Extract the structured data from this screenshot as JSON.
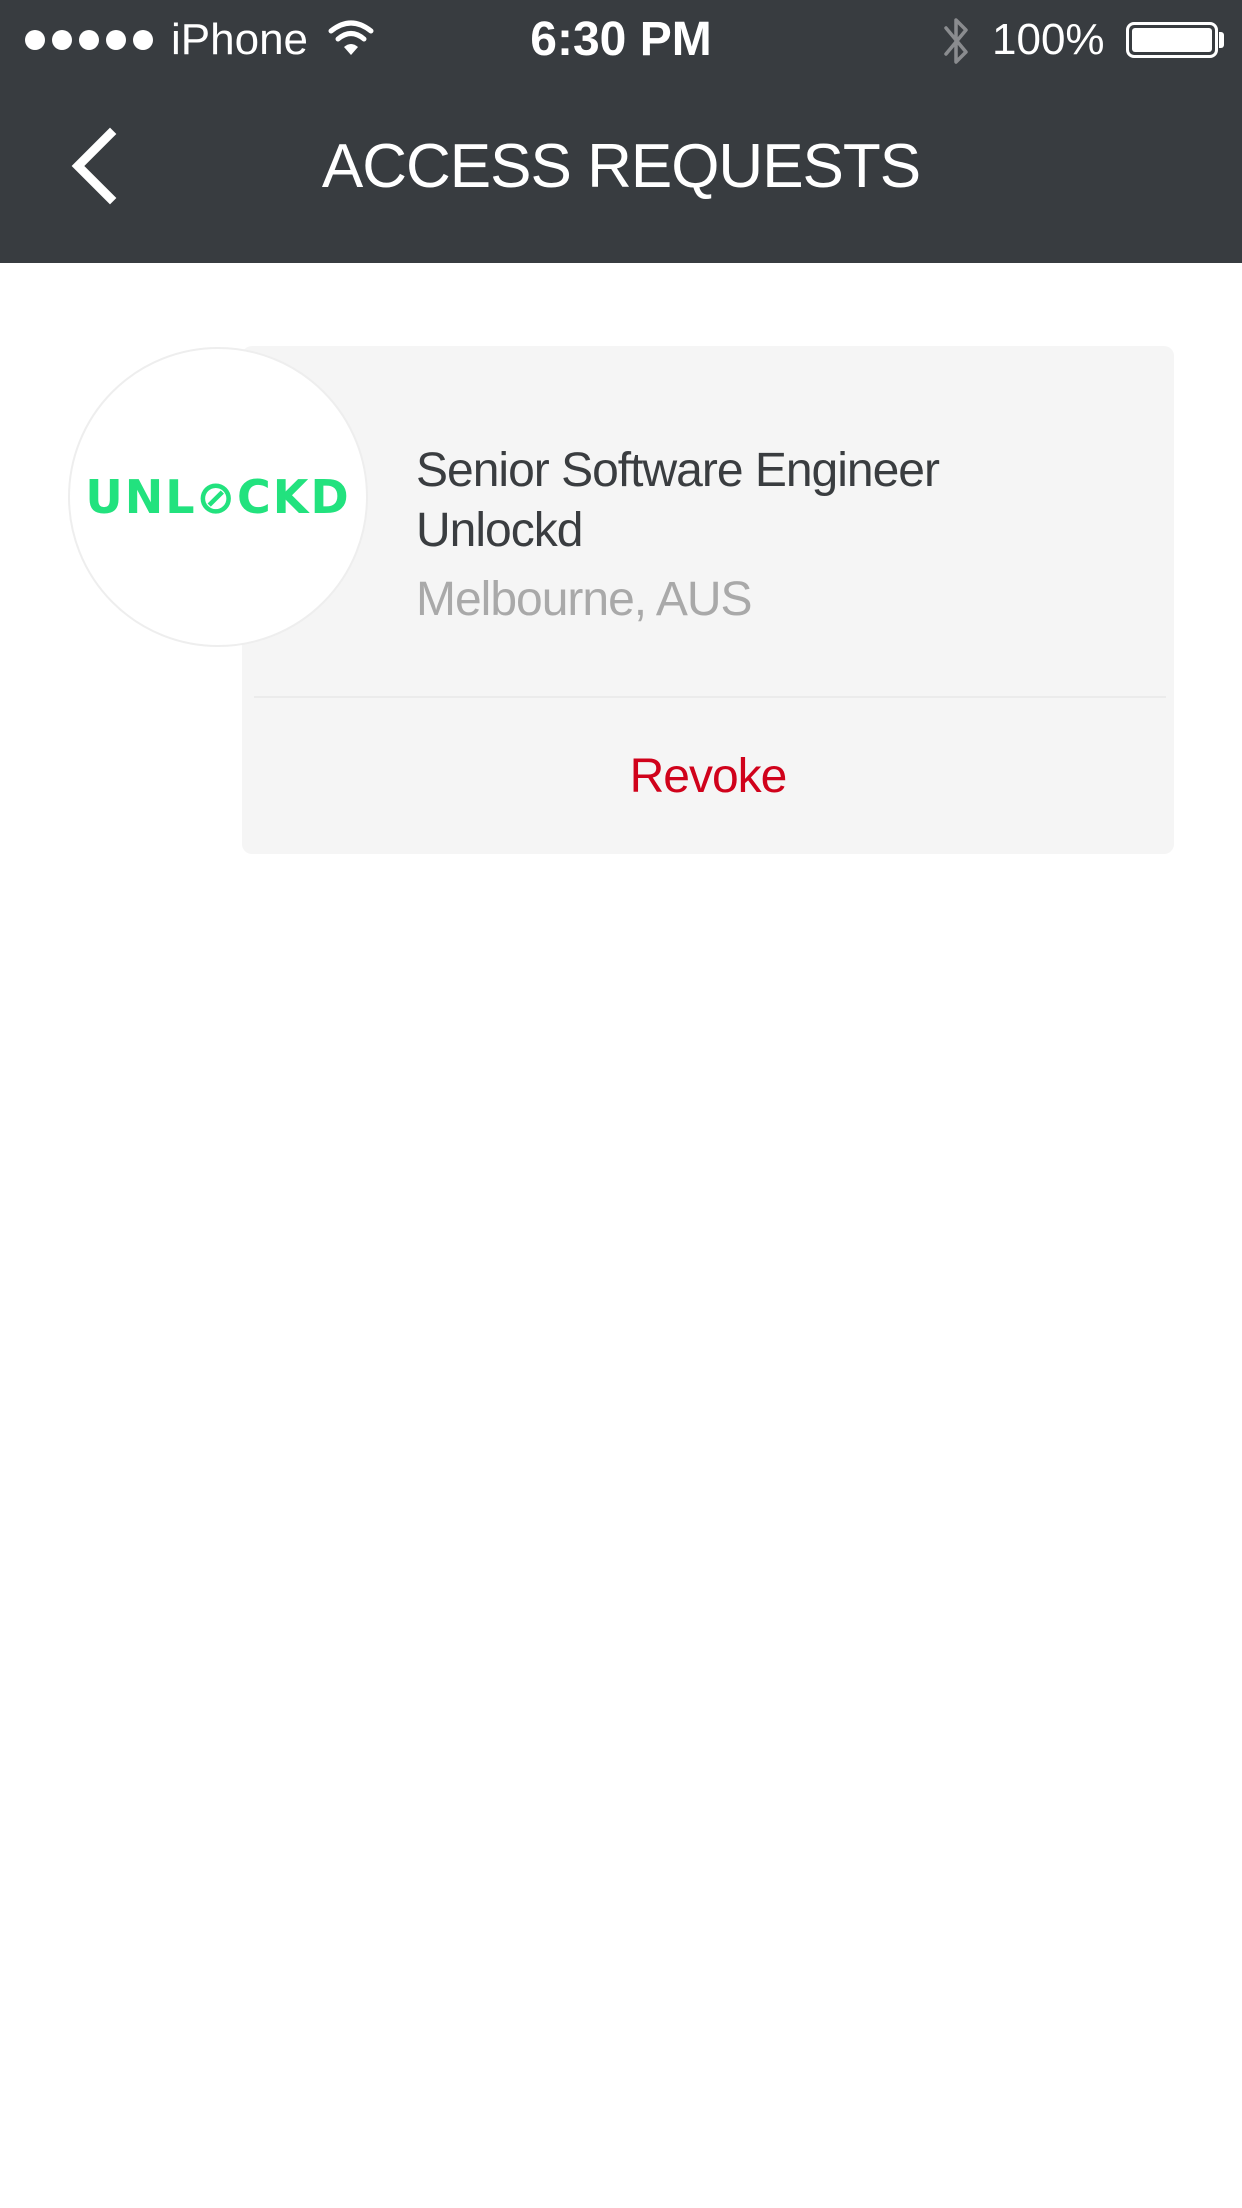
{
  "status_bar": {
    "carrier": "iPhone",
    "time": "6:30 PM",
    "battery_percent": "100%",
    "signal_bars": 5,
    "icons": [
      "signal-dots-icon",
      "wifi-icon",
      "bluetooth-icon",
      "battery-icon"
    ]
  },
  "nav": {
    "title": "ACCESS REQUESTS",
    "back_icon": "chevron-left-icon"
  },
  "request": {
    "logo_text": "UNL⊘CKD",
    "job_title": "Senior Software Engineer",
    "company": "Unlockd",
    "location": "Melbourne, AUS",
    "action_label": "Revoke"
  },
  "colors": {
    "header_bg": "#383c40",
    "card_bg": "#f5f5f5",
    "revoke": "#d0021b",
    "logo": "#22e27e",
    "primary_text": "#3a3d40",
    "secondary_text": "#a9a9a9"
  }
}
